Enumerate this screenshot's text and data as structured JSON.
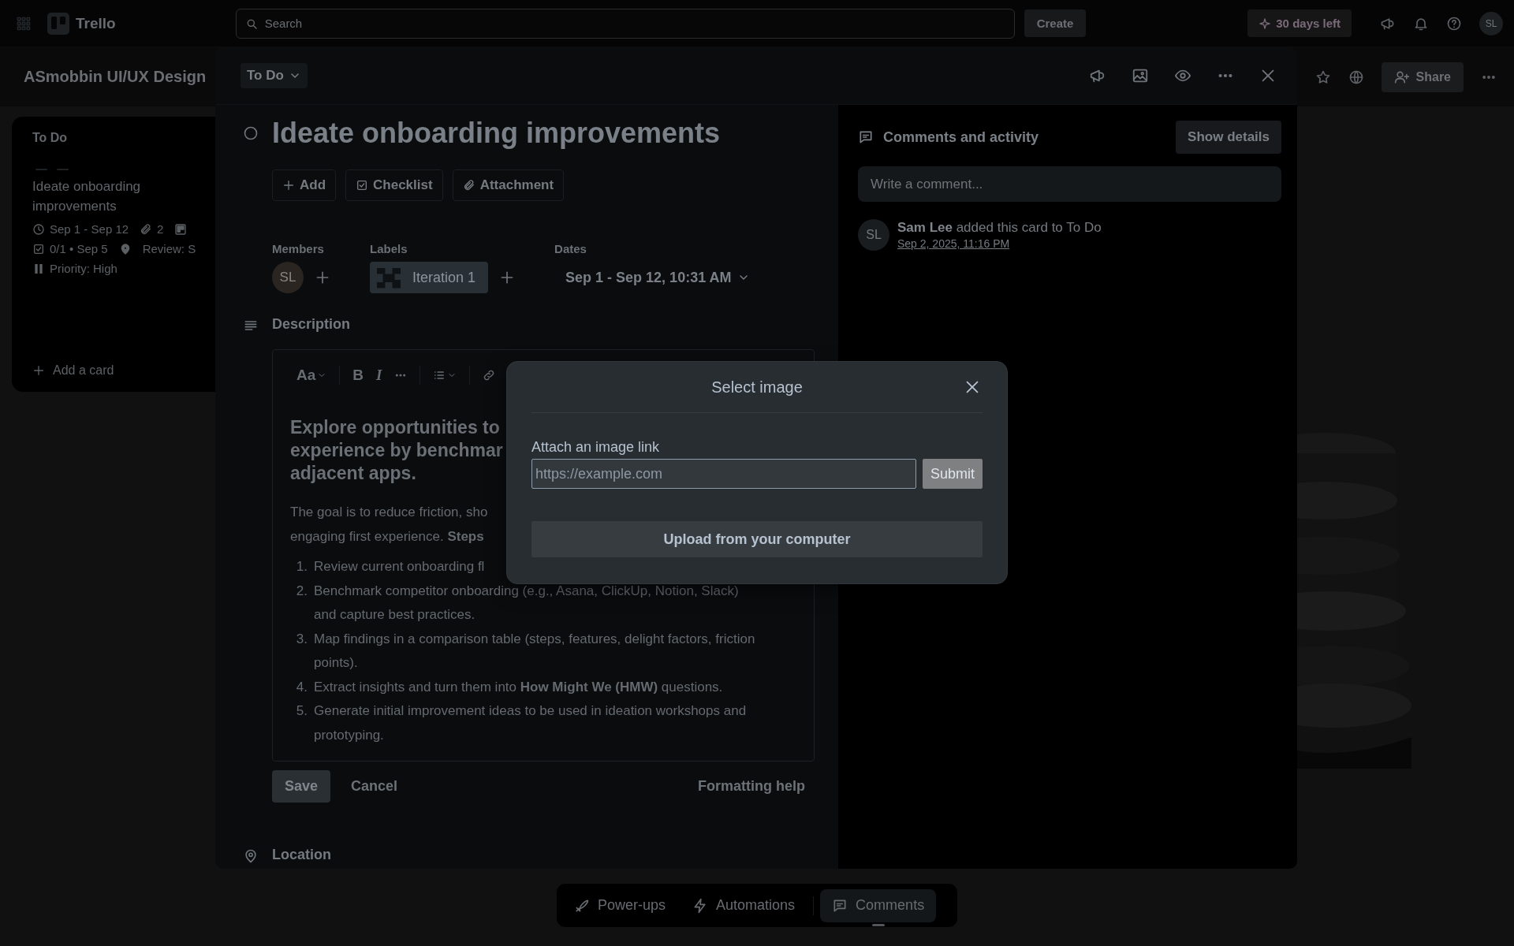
{
  "top_bar": {
    "app_name": "Trello",
    "search": {
      "placeholder": "Search"
    },
    "create_button": "Create",
    "trial_button": "30 days left",
    "avatar": "SL"
  },
  "board": {
    "title": "ASmobbin UI/UX Design",
    "share_button": "Share"
  },
  "list": {
    "title": "To Do",
    "card": {
      "title": "Ideate onboarding improvements",
      "badge_rows": [
        [
          {
            "kind": "dates",
            "text": "Sep 1 - Sep 12"
          },
          {
            "kind": "attachments",
            "text": "2"
          },
          {
            "kind": "board"
          }
        ],
        [
          {
            "kind": "checklist",
            "text": "0/1 • Sep 5"
          },
          {
            "kind": "location"
          },
          {
            "kind": "field",
            "text": "Review: S"
          }
        ],
        [
          {
            "kind": "priority",
            "text": "Priority: High"
          }
        ]
      ]
    },
    "add_card": "Add a card"
  },
  "card_modal": {
    "list_button": "To Do",
    "title": "Ideate onboarding improvements",
    "actions": [
      {
        "kind": "add",
        "label": "Add"
      },
      {
        "kind": "checklist",
        "label": "Checklist"
      },
      {
        "kind": "attachment",
        "label": "Attachment"
      }
    ],
    "members": {
      "label": "Members",
      "avatars": [
        "SL"
      ]
    },
    "labels": {
      "label": "Labels",
      "items": [
        "Iteration 1"
      ]
    },
    "dates": {
      "label": "Dates",
      "value": "Sep 1 - Sep 12, 10:31 AM"
    },
    "description": {
      "label": "Description",
      "toolbar": [
        {
          "kind": "text_style",
          "label": "Aa"
        },
        {
          "kind": "bold",
          "label": "B"
        },
        {
          "kind": "italic",
          "label": "I"
        },
        {
          "kind": "more"
        },
        {
          "kind": "list"
        },
        {
          "kind": "link"
        }
      ],
      "heading_lines": [
        "Explore opportunities to",
        "experience by benchmar",
        "adjacent apps."
      ],
      "paragraph_lines": [
        "The goal is to reduce friction, sho",
        "engaging first experience. **Steps**"
      ],
      "items": [
        {
          "number": "1.",
          "text": "Review current onboarding fl"
        },
        {
          "number": "2.",
          "text": "Benchmark competitor onboarding (e.g., Asana, ClickUp, Notion, Slack) and capture best practices."
        },
        {
          "number": "3.",
          "text": "Map findings in a comparison table (steps, features, delight factors, friction points)."
        },
        {
          "number": "4.",
          "text": "Extract insights and turn them into **How Might We (HMW)** questions."
        },
        {
          "number": "5.",
          "text": "Generate initial improvement ideas to be used in ideation workshops and prototyping."
        }
      ],
      "save": "Save",
      "cancel": "Cancel",
      "help": "Formatting help"
    },
    "location": {
      "label": "Location"
    },
    "activity": {
      "title": "Comments and activity",
      "show_details": "Show details",
      "comment": {
        "placeholder": "Write a comment..."
      },
      "entries": [
        {
          "avatar": "SL",
          "text": "**Sam Lee** added this card to To Do",
          "time": "Sep 2, 2025, 11:16 PM"
        }
      ]
    }
  },
  "dialog": {
    "title": "Select image",
    "link_label": "Attach an image link",
    "link_field": {
      "placeholder": "https://example.com"
    },
    "submit": "Submit",
    "upload": "Upload from your computer"
  },
  "bottom_bar": [
    {
      "kind": "power-ups",
      "label": "Power-ups",
      "selected": false
    },
    {
      "kind": "automations",
      "label": "Automations",
      "selected": false
    },
    {
      "kind": "comments",
      "label": "Comments",
      "selected": true
    }
  ]
}
